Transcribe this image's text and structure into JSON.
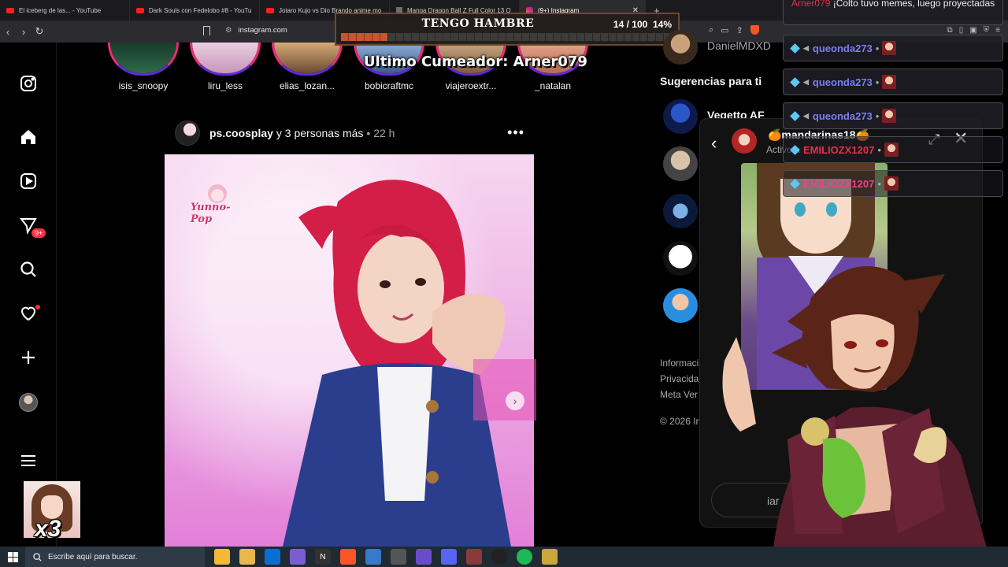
{
  "browser": {
    "tabs": [
      {
        "title": "El iceberg de las... - YouTube",
        "icon": "youtube-icon"
      },
      {
        "title": "Dark Souls con Fedelobo #8 - YouTu",
        "icon": "youtube-icon"
      },
      {
        "title": "Jotaro Kujo vs Dio Brando anime mo",
        "icon": "youtube-icon"
      },
      {
        "title": "Manga Dragon Ball Z Full Color 13 O",
        "icon": "manga-icon"
      },
      {
        "title": "(9+) Instagram",
        "icon": "instagram-icon",
        "active": true
      }
    ],
    "url": "instagram.com"
  },
  "nav": {
    "notification_badge": "9+"
  },
  "stories": [
    {
      "name": "isis_snoopy"
    },
    {
      "name": "liru_less"
    },
    {
      "name": "elias_lozan..."
    },
    {
      "name": "bobicraftmc"
    },
    {
      "name": "viajeroextr..."
    },
    {
      "name": "_natalan"
    }
  ],
  "post": {
    "author": "ps.coosplay",
    "others": "y 3 personas más",
    "time": "• 22 h",
    "brand": "Yunno-Pop"
  },
  "hunger_bar": {
    "title": "TENGO HAMBRE",
    "count": "14 / 100",
    "percent_label": "14%",
    "progress": 0.14
  },
  "last_cumeador": "Ultimo Cumeador: Arner079",
  "sidebar_right": {
    "top_user": "DanielMDXD",
    "suggestions_title": "Sugerencias para ti",
    "suggestions": [
      {
        "name": "Vegetto AF"
      }
    ],
    "footer_links": [
      "Informaci",
      "Privacidad",
      "Meta Ver",
      "© 2026 In"
    ]
  },
  "chat_popup": {
    "name": "🍊mandarinas18🍊",
    "status": "Activo a",
    "input_placeholder": "iar me"
  },
  "stream_chat": [
    {
      "user": "Arner079",
      "text": "¡Colto tuvo memes, luego proyectadas"
    },
    {
      "user": "queonda273",
      "color": "#7b7ff3"
    },
    {
      "user": "queonda273",
      "color": "#7b7ff3"
    },
    {
      "user": "queonda273",
      "color": "#7b7ff3"
    },
    {
      "user": "EMILIOZX1207",
      "color": "#e8304c"
    },
    {
      "user": "EMILIOZX1207",
      "color": "#f0408a"
    }
  ],
  "minicam": {
    "multiplier": "x3"
  },
  "taskbar": {
    "search_placeholder": "Escribe aquí para buscar."
  }
}
